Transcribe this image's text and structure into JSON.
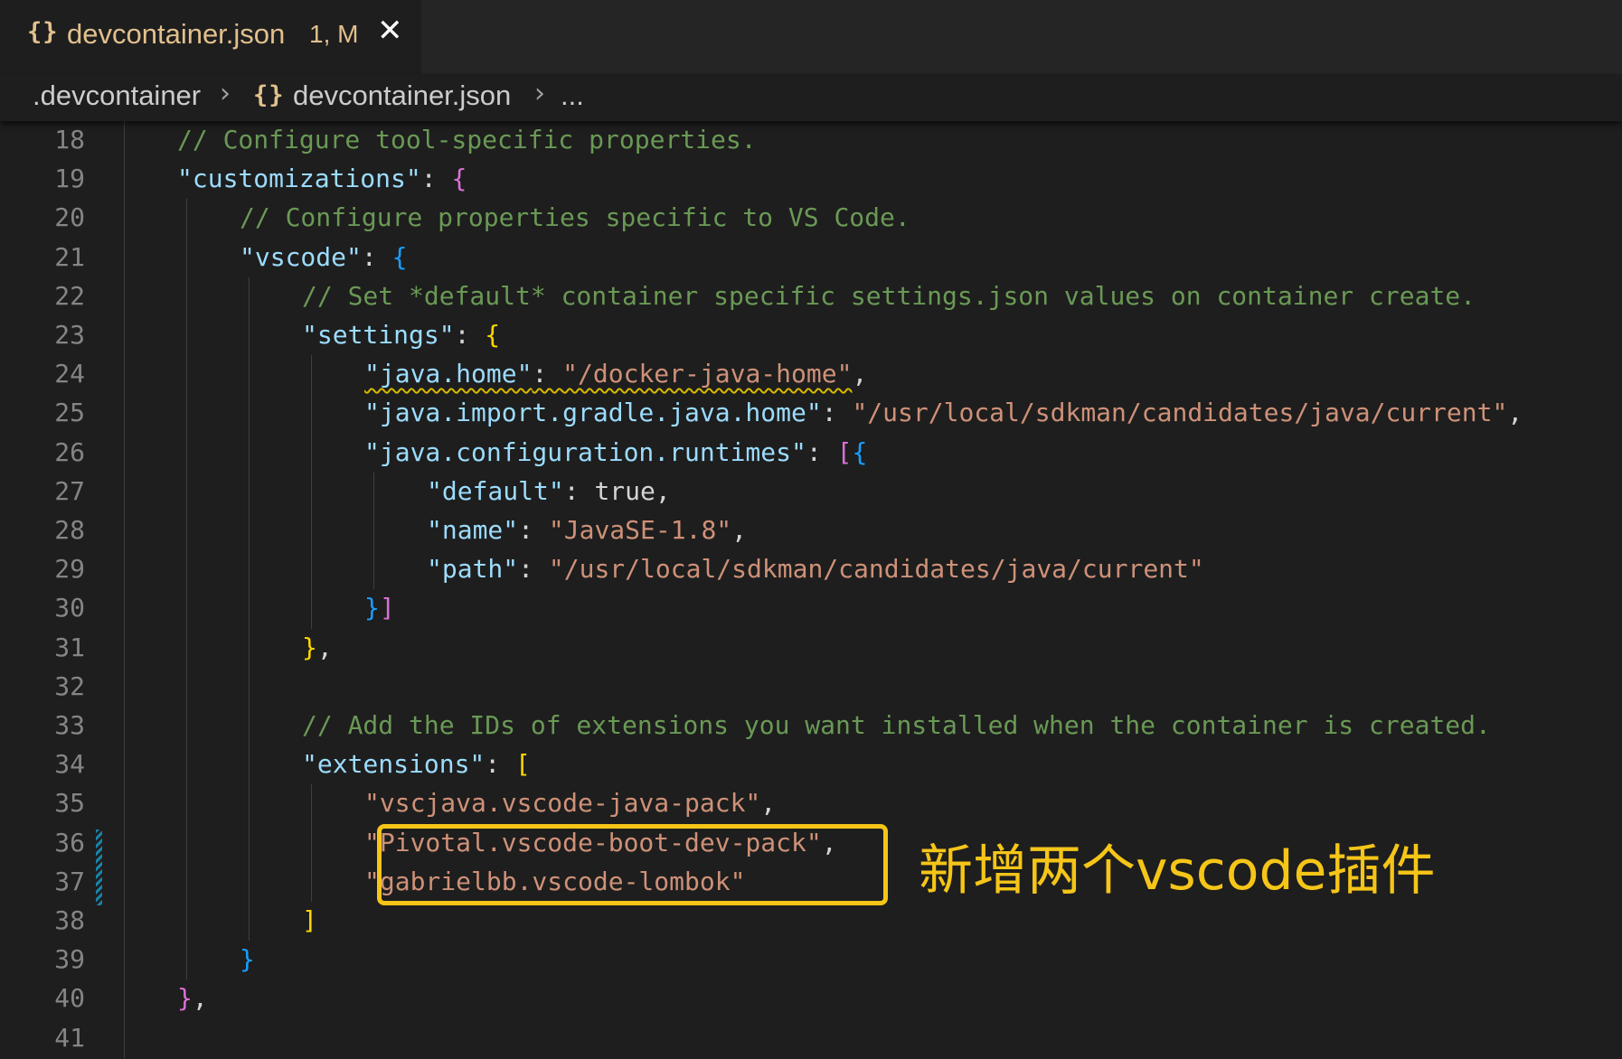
{
  "tab": {
    "icon": "{}",
    "title": "devcontainer.json",
    "status": "1, M",
    "close": "✕"
  },
  "breadcrumb": {
    "folder": ".devcontainer",
    "icon": "{}",
    "file": "devcontainer.json",
    "more": "..."
  },
  "colors": {
    "comment": "#6a9955",
    "key": "#9cdcfe",
    "string": "#ce9178",
    "annotation": "#f5c518"
  },
  "lines": [
    {
      "n": "18",
      "indent": 2,
      "tokens": [
        [
          "comment",
          "// Configure tool-specific properties."
        ]
      ]
    },
    {
      "n": "19",
      "indent": 2,
      "tokens": [
        [
          "key",
          "\"customizations\""
        ],
        [
          "punc",
          ": "
        ],
        [
          "b2",
          "{"
        ]
      ]
    },
    {
      "n": "20",
      "indent": 3,
      "tokens": [
        [
          "comment",
          "// Configure properties specific to VS Code."
        ]
      ]
    },
    {
      "n": "21",
      "indent": 3,
      "tokens": [
        [
          "key",
          "\"vscode\""
        ],
        [
          "punc",
          ": "
        ],
        [
          "b3",
          "{"
        ]
      ]
    },
    {
      "n": "22",
      "indent": 4,
      "tokens": [
        [
          "comment",
          "// Set *default* container specific settings.json values on container create."
        ]
      ]
    },
    {
      "n": "23",
      "indent": 4,
      "tokens": [
        [
          "key",
          "\"settings\""
        ],
        [
          "punc",
          ": "
        ],
        [
          "b1",
          "{"
        ]
      ]
    },
    {
      "n": "24",
      "indent": 5,
      "tokens": [
        [
          "key squiggle",
          "\"java.home\""
        ],
        [
          "punc squiggle",
          ": "
        ],
        [
          "str squiggle",
          "\"/docker-java-home\""
        ],
        [
          "punc",
          ","
        ]
      ]
    },
    {
      "n": "25",
      "indent": 5,
      "tokens": [
        [
          "key",
          "\"java.import.gradle.java.home\""
        ],
        [
          "punc",
          ": "
        ],
        [
          "str",
          "\"/usr/local/sdkman/candidates/java/current\""
        ],
        [
          "punc",
          ","
        ]
      ]
    },
    {
      "n": "26",
      "indent": 5,
      "tokens": [
        [
          "key",
          "\"java.configuration.runtimes\""
        ],
        [
          "punc",
          ": "
        ],
        [
          "b2",
          "["
        ],
        [
          "b3",
          "{"
        ]
      ]
    },
    {
      "n": "27",
      "indent": 6,
      "tokens": [
        [
          "key",
          "\"default\""
        ],
        [
          "punc",
          ": "
        ],
        [
          "bool",
          "true"
        ],
        [
          "punc",
          ","
        ]
      ]
    },
    {
      "n": "28",
      "indent": 6,
      "tokens": [
        [
          "key",
          "\"name\""
        ],
        [
          "punc",
          ": "
        ],
        [
          "str",
          "\"JavaSE-1.8\""
        ],
        [
          "punc",
          ","
        ]
      ]
    },
    {
      "n": "29",
      "indent": 6,
      "tokens": [
        [
          "key",
          "\"path\""
        ],
        [
          "punc",
          ": "
        ],
        [
          "str",
          "\"/usr/local/sdkman/candidates/java/current\""
        ]
      ]
    },
    {
      "n": "30",
      "indent": 5,
      "tokens": [
        [
          "b3",
          "}"
        ],
        [
          "b2",
          "]"
        ]
      ]
    },
    {
      "n": "31",
      "indent": 4,
      "tokens": [
        [
          "b1",
          "}"
        ],
        [
          "punc",
          ","
        ]
      ]
    },
    {
      "n": "32",
      "indent": 4,
      "tokens": []
    },
    {
      "n": "33",
      "indent": 4,
      "tokens": [
        [
          "comment",
          "// Add the IDs of extensions you want installed when the container is created."
        ]
      ]
    },
    {
      "n": "34",
      "indent": 4,
      "tokens": [
        [
          "key",
          "\"extensions\""
        ],
        [
          "punc",
          ": "
        ],
        [
          "b1",
          "["
        ]
      ]
    },
    {
      "n": "35",
      "indent": 5,
      "tokens": [
        [
          "str",
          "\"vscjava.vscode-java-pack\""
        ],
        [
          "punc",
          ","
        ]
      ]
    },
    {
      "n": "36",
      "indent": 5,
      "tokens": [
        [
          "str",
          "\"Pivotal.vscode-boot-dev-pack\""
        ],
        [
          "punc",
          ","
        ]
      ]
    },
    {
      "n": "37",
      "indent": 5,
      "tokens": [
        [
          "str",
          "\"gabrielbb.vscode-lombok\""
        ]
      ]
    },
    {
      "n": "38",
      "indent": 4,
      "tokens": [
        [
          "b1",
          "]"
        ]
      ]
    },
    {
      "n": "39",
      "indent": 3,
      "tokens": [
        [
          "b3",
          "}"
        ]
      ]
    },
    {
      "n": "40",
      "indent": 2,
      "tokens": [
        [
          "b2",
          "}"
        ],
        [
          "punc",
          ","
        ]
      ]
    },
    {
      "n": "41",
      "indent": 2,
      "tokens": []
    }
  ],
  "annotation": "新增两个vscode插件"
}
